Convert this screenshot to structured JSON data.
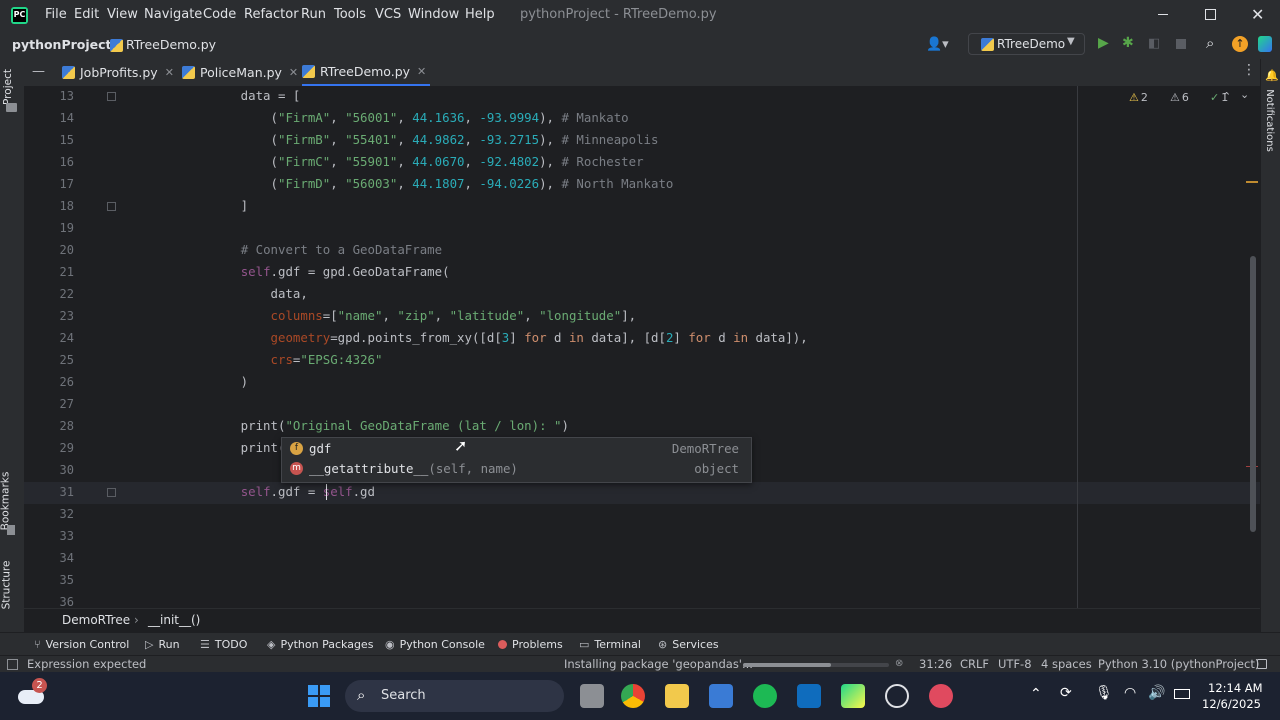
{
  "menu": [
    "File",
    "Edit",
    "View",
    "Navigate",
    "Code",
    "Refactor",
    "Run",
    "Tools",
    "VCS",
    "Window",
    "Help"
  ],
  "window_title": "pythonProject - RTreeDemo.py",
  "nav": {
    "project": "pythonProject",
    "file": "RTreeDemo.py",
    "run_config": "RTreeDemo"
  },
  "tabs": [
    {
      "label": "JobProfits.py"
    },
    {
      "label": "PoliceMan.py"
    },
    {
      "label": "RTreeDemo.py"
    }
  ],
  "left_tools": {
    "project": "Project",
    "bookmarks": "Bookmarks",
    "structure": "Structure"
  },
  "right_tools": {
    "notifications": "Notifications"
  },
  "inspections": {
    "warnings": "2",
    "weak_warnings": "6",
    "typos": "1"
  },
  "line_numbers": [
    "13",
    "14",
    "15",
    "16",
    "17",
    "18",
    "19",
    "20",
    "21",
    "22",
    "23",
    "24",
    "25",
    "26",
    "27",
    "28",
    "29",
    "30",
    "31",
    "32",
    "33",
    "34",
    "35",
    "36"
  ],
  "code_lines": [
    "        data = [",
    "            (\"FirmA\", \"56001\", 44.1636, -93.9994), # Mankato",
    "            (\"FirmB\", \"55401\", 44.9862, -93.2715), # Minneapolis",
    "            (\"FirmC\", \"55901\", 44.0670, -92.4802), # Rochester",
    "            (\"FirmD\", \"56003\", 44.1807, -94.0226), # North Mankato",
    "        ]",
    "",
    "        # Convert to a GeoDataFrame",
    "        self.gdf = gpd.GeoDataFrame(",
    "            data,",
    "            columns=[\"name\", \"zip\", \"latitude\", \"longitude\"],",
    "            geometry=gpd.points_from_xy([d[3] for d in data], [d[2] for d in data]),",
    "            crs=\"EPSG:4326\"",
    "        )",
    "",
    "        print(\"Original GeoDataFrame (lat / lon): \")",
    "        print(self.gc",
    "",
    "        self.gdf = self.gd",
    "",
    "",
    "",
    "",
    ""
  ],
  "completion": [
    {
      "badge": "f",
      "name": "gdf",
      "args": "",
      "type": "DemoRTree"
    },
    {
      "badge": "m",
      "name": "__getattribute__",
      "args": "(self, name)",
      "type": "object"
    }
  ],
  "breadcrumb": {
    "cls": "DemoRTree",
    "method": "__init__()"
  },
  "tool_windows": [
    "Version Control",
    "Run",
    "TODO",
    "Python Packages",
    "Python Console",
    "Problems",
    "Terminal",
    "Services"
  ],
  "status": {
    "message": "Expression expected",
    "task": "Installing package 'geopandas'...",
    "position": "31:26",
    "line_sep": "CRLF",
    "encoding": "UTF-8",
    "indent": "4 spaces",
    "interpreter": "Python 3.10 (pythonProject)"
  },
  "taskbar": {
    "search": "Search",
    "time": "12:14 AM",
    "date": "12/6/2025",
    "badge": "2"
  },
  "colors": {
    "accent": "#3574f0",
    "run": "#57a64a",
    "bg": "#1e1f22"
  }
}
